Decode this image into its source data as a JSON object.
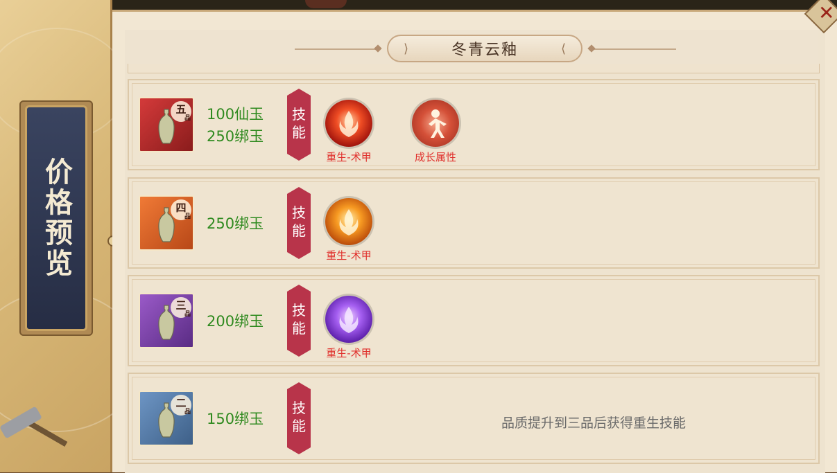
{
  "side": {
    "title": "价格预览"
  },
  "header": {
    "title": "冬青云釉"
  },
  "rows": [
    {
      "quality": "q5",
      "grade": "五",
      "grade_suffix": "品",
      "prices": [
        "100仙玉",
        "250绑玉"
      ],
      "skill_tag": [
        "技",
        "能"
      ],
      "skills": [
        {
          "name": "重生-术甲",
          "style": "red"
        },
        {
          "name": "成长属性",
          "style": "growth"
        }
      ],
      "hint": ""
    },
    {
      "quality": "q4",
      "grade": "四",
      "grade_suffix": "品",
      "prices": [
        "250绑玉"
      ],
      "skill_tag": [
        "技",
        "能"
      ],
      "skills": [
        {
          "name": "重生-术甲",
          "style": "orange"
        }
      ],
      "hint": ""
    },
    {
      "quality": "q3",
      "grade": "三",
      "grade_suffix": "品",
      "prices": [
        "200绑玉"
      ],
      "skill_tag": [
        "技",
        "能"
      ],
      "skills": [
        {
          "name": "重生-术甲",
          "style": "purple"
        }
      ],
      "hint": ""
    },
    {
      "quality": "q2",
      "grade": "二",
      "grade_suffix": "品",
      "prices": [
        "150绑玉"
      ],
      "skill_tag": [
        "技",
        "能"
      ],
      "skills": [],
      "hint": "品质提升到三品后获得重生技能"
    }
  ],
  "colors": {
    "price": "#2f8a1f",
    "skill_label": "#e0302c",
    "tag": "#b8344a",
    "hint": "#6a6a6a"
  },
  "icons": {
    "close": "close-icon",
    "vase": "vase-icon",
    "skill": "rebirth-flame-icon",
    "growth": "growth-figure-icon"
  }
}
